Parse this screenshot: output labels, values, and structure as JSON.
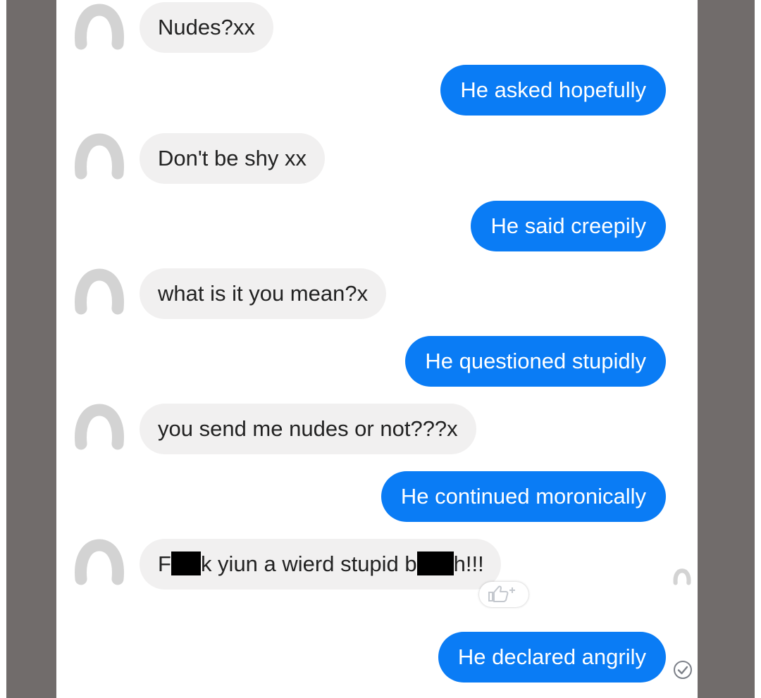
{
  "conversation": {
    "messages": [
      {
        "side": "incoming",
        "text": "Nudes?xx"
      },
      {
        "side": "outgoing",
        "text": "He asked hopefully"
      },
      {
        "side": "incoming",
        "text": "Don't be shy xx"
      },
      {
        "side": "outgoing",
        "text": "He said creepily"
      },
      {
        "side": "incoming",
        "text": "what is it you mean?x"
      },
      {
        "side": "outgoing",
        "text": "He questioned stupidly"
      },
      {
        "side": "incoming",
        "text": "you send me nudes or not???x"
      },
      {
        "side": "outgoing",
        "text": "He continued moronically"
      },
      {
        "side": "incoming",
        "text_parts": [
          "F",
          "k yiun a wierd stupid b",
          "h!!!"
        ],
        "redacted": true
      },
      {
        "side": "outgoing",
        "text": "He declared angrily"
      }
    ]
  },
  "icons": {
    "avatar": "person-placeholder-icon",
    "like": "thumbs-up-plus-icon",
    "seen": "seen-check-icon"
  },
  "colors": {
    "incoming_bubble": "#f1f0f0",
    "outgoing_bubble": "#0a7cf5",
    "incoming_text": "#222222",
    "outgoing_text": "#ffffff",
    "side_bars": "#716c6b"
  }
}
